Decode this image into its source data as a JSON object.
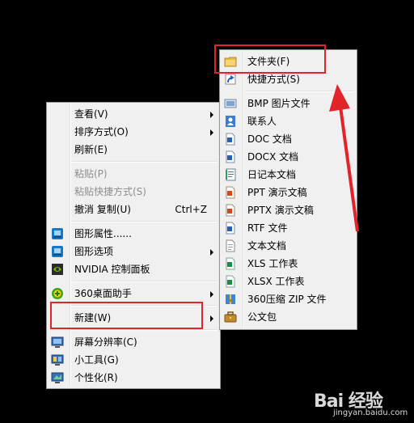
{
  "context_menu": {
    "items": [
      {
        "label": "查看(V)",
        "submenu": true
      },
      {
        "label": "排序方式(O)",
        "submenu": true
      },
      {
        "label": "刷新(E)"
      },
      {
        "label": "粘贴(P)",
        "disabled": true
      },
      {
        "label": "粘贴快捷方式(S)",
        "disabled": true
      },
      {
        "label": "撤消 复制(U)",
        "shortcut": "Ctrl+Z"
      },
      {
        "label": "图形属性......",
        "icon": "intel-graphics-icon"
      },
      {
        "label": "图形选项",
        "icon": "intel-graphics-icon",
        "submenu": true
      },
      {
        "label": "NVIDIA 控制面板",
        "icon": "nvidia-icon"
      },
      {
        "label": "360桌面助手",
        "icon": "360-icon",
        "submenu": true
      },
      {
        "label": "新建(W)",
        "submenu": true
      },
      {
        "label": "屏幕分辨率(C)",
        "icon": "screen-resolution-icon"
      },
      {
        "label": "小工具(G)",
        "icon": "gadgets-icon"
      },
      {
        "label": "个性化(R)",
        "icon": "personalize-icon"
      }
    ]
  },
  "new_submenu": {
    "items": [
      {
        "label": "文件夹(F)",
        "icon": "folder-icon"
      },
      {
        "label": "快捷方式(S)",
        "icon": "shortcut-icon"
      },
      {
        "label": "BMP 图片文件",
        "icon": "bmp-file-icon"
      },
      {
        "label": "联系人",
        "icon": "contact-icon"
      },
      {
        "label": "DOC 文档",
        "icon": "doc-file-icon"
      },
      {
        "label": "DOCX 文档",
        "icon": "docx-file-icon"
      },
      {
        "label": "日记本文档",
        "icon": "journal-file-icon"
      },
      {
        "label": "PPT 演示文稿",
        "icon": "ppt-file-icon"
      },
      {
        "label": "PPTX 演示文稿",
        "icon": "pptx-file-icon"
      },
      {
        "label": "RTF 文件",
        "icon": "rtf-file-icon"
      },
      {
        "label": "文本文档",
        "icon": "txt-file-icon"
      },
      {
        "label": "XLS 工作表",
        "icon": "xls-file-icon"
      },
      {
        "label": "XLSX 工作表",
        "icon": "xlsx-file-icon"
      },
      {
        "label": "360压缩 ZIP 文件",
        "icon": "zip-file-icon"
      },
      {
        "label": "公文包",
        "icon": "briefcase-icon"
      }
    ]
  },
  "colors": {
    "annotation": "#e2232a",
    "menu_bg": "#f0f0f0",
    "disabled_text": "#8d8d8d"
  },
  "watermark": {
    "logo": "Bai 经验",
    "url": "jingyan.baidu.com"
  }
}
